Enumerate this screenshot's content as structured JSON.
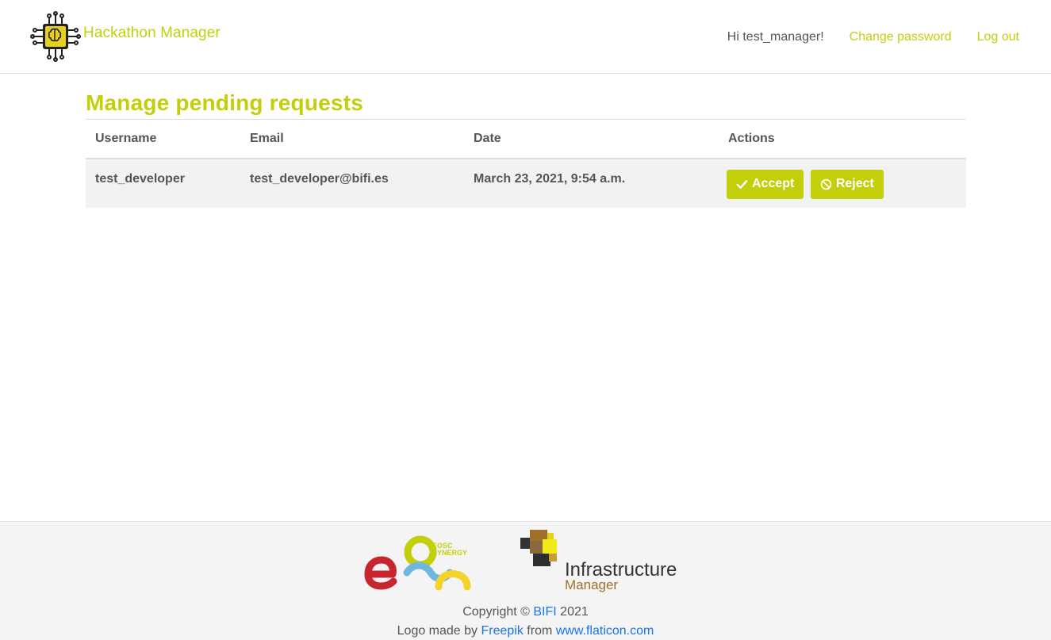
{
  "header": {
    "brand": "Hackathon Manager",
    "greeting": "Hi test_manager!",
    "change_password": "Change password",
    "logout": "Log out"
  },
  "main": {
    "title": "Manage pending requests",
    "columns": [
      "Username",
      "Email",
      "Date",
      "Actions"
    ],
    "rows": [
      {
        "username": "test_developer",
        "email": "test_developer@bifi.es",
        "date": "March 23, 2021, 9:54 a.m.",
        "accept_label": "Accept",
        "reject_label": "Reject"
      }
    ]
  },
  "footer": {
    "eosc_logo_text": "EOSC SYNERGY",
    "im_logo_title": "Infrastructure",
    "im_logo_subtitle": "Manager",
    "copyright_prefix": "Copyright © ",
    "copyright_link": "BIFI",
    "copyright_suffix": " 2021",
    "credit_prefix": "Logo made by ",
    "credit_author": "Freepik",
    "credit_middle": " from ",
    "credit_site": "www.flaticon.com"
  },
  "colors": {
    "accent": "#c3cf0a",
    "link": "#1a73e8",
    "text": "#555555",
    "row_bg": "#f2f2f2"
  },
  "icons": {
    "brand": "circuit-brain-icon",
    "accept": "check-icon",
    "reject": "ban-icon"
  }
}
